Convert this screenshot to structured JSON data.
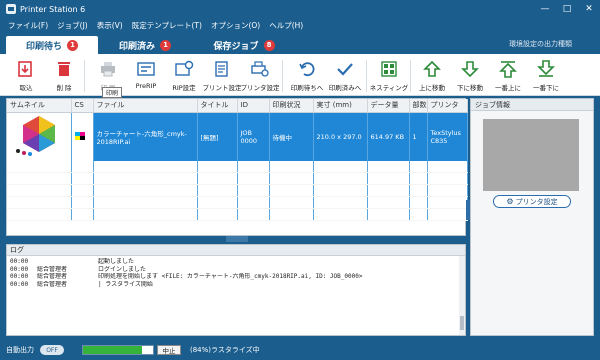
{
  "window": {
    "title": "Printer Station 6"
  },
  "menu": [
    "ファイル(F)",
    "ジョブ(J)",
    "表示(V)",
    "既定テンプレート(T)",
    "オプション(O)",
    "ヘルプ(H)"
  ],
  "tabs": [
    {
      "label": "印刷待ち",
      "count": "1"
    },
    {
      "label": "印刷済み",
      "count": "1"
    },
    {
      "label": "保存ジョブ",
      "count": "8"
    }
  ],
  "tab_hint": "環境設定の出力種類",
  "toolbar": {
    "import": "取込",
    "delete": "削 除",
    "print": "印 刷",
    "prerip": "PreRIP",
    "rip_settings": "RIP設定",
    "print_settings": "プリント設定",
    "printer_settings": "プリンタ設定",
    "to_queue": "印刷待ちへ",
    "to_done": "印刷済みへ",
    "nesting": "ネスティング",
    "move_up": "上に移動",
    "move_down": "下に移動",
    "move_top": "一番上に",
    "move_bottom": "一番下に"
  },
  "tooltip": "印刷",
  "table": {
    "headers": [
      "サムネイル",
      "CS",
      "ファイル",
      "タイトル",
      "ID",
      "印刷状況",
      "実寸 (mm)",
      "データ量",
      "部数",
      "プリンタ"
    ],
    "rows": [
      {
        "file": "カラーチャート-六角形_cmyk-2018RIP.ai",
        "title": "[無題]",
        "id": "JOB 0000",
        "status": "待機中",
        "size": "210.0 x 297.0",
        "data": "614.97 KB",
        "copies": "1",
        "printer": "TexStylus C835"
      }
    ]
  },
  "side": {
    "title": "ジョブ情報",
    "printer_button": "プリンタ設定"
  },
  "log": {
    "title": "ログ",
    "lines": [
      {
        "time": "00:00",
        "user": "",
        "msg": "起動しました"
      },
      {
        "time": "00:00",
        "user": "総合管理者",
        "msg": "ログインしました"
      },
      {
        "time": "00:00",
        "user": "総合管理者",
        "msg": "印刷処理を開始します <FILE: カラーチャート-六角形_cmyk-2018RIP.ai, ID: JOB_0000>"
      },
      {
        "time": "00:00",
        "user": "総合管理者",
        "msg": "|  ラスタライズ開始"
      }
    ]
  },
  "status": {
    "auto_output_label": "自動出力",
    "toggle": "OFF",
    "progress": 0.84,
    "stop": "中止",
    "message": "(84%)ラスタライズ中"
  },
  "colors": {
    "accent": "#1b5e8e",
    "selection": "#1f87d6",
    "badge": "#e03b3b",
    "progress": "#35b33a"
  }
}
